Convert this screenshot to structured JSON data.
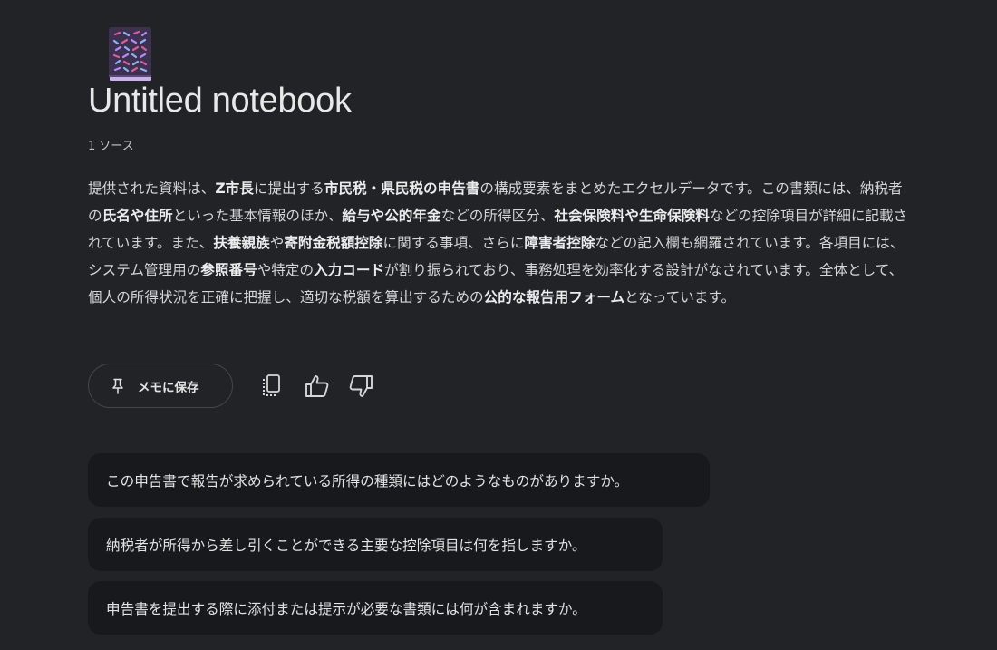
{
  "notebook": {
    "icon": "notebook-cover-icon",
    "title": "Untitled notebook",
    "source_count": "1 ソース"
  },
  "summary": [
    {
      "text": "提供された資料は、",
      "bold": false
    },
    {
      "text": "Z市長",
      "bold": true
    },
    {
      "text": "に提出する",
      "bold": false
    },
    {
      "text": "市民税・県民税の申告書",
      "bold": true
    },
    {
      "text": "の構成要素をまとめたエクセルデータです。この書類には、納税者の",
      "bold": false
    },
    {
      "text": "氏名や住所",
      "bold": true
    },
    {
      "text": "といった基本情報のほか、",
      "bold": false
    },
    {
      "text": "給与や公的年金",
      "bold": true
    },
    {
      "text": "などの所得区分、",
      "bold": false
    },
    {
      "text": "社会保険料や生命保険料",
      "bold": true
    },
    {
      "text": "などの控除項目が詳細に記載されています。また、",
      "bold": false
    },
    {
      "text": "扶養親族",
      "bold": true
    },
    {
      "text": "や",
      "bold": false
    },
    {
      "text": "寄附金税額控除",
      "bold": true
    },
    {
      "text": "に関する事項、さらに",
      "bold": false
    },
    {
      "text": "障害者控除",
      "bold": true
    },
    {
      "text": "などの記入欄も網羅されています。各項目には、システム管理用の",
      "bold": false
    },
    {
      "text": "参照番号",
      "bold": true
    },
    {
      "text": "や特定の",
      "bold": false
    },
    {
      "text": "入力コード",
      "bold": true
    },
    {
      "text": "が割り振られており、事務処理を効率化する設計がなされています。全体として、個人の所得状況を正確に把握し、適切な税額を算出するための",
      "bold": false
    },
    {
      "text": "公的な報告用フォーム",
      "bold": true
    },
    {
      "text": "となっています。",
      "bold": false
    }
  ],
  "actions": {
    "save_label": "メモに保存",
    "save_icon": "pin-icon",
    "copy_icon": "copy-icon",
    "like_icon": "thumbs-up-icon",
    "dislike_icon": "thumbs-down-icon"
  },
  "suggested_questions": [
    "この申告書で報告が求められている所得の種類にはどのようなものがありますか。",
    "納税者が所得から差し引くことができる主要な控除項目は何を指しますか。",
    "申告書を提出する際に添付または提示が必要な書類には何が含まれますか。"
  ]
}
